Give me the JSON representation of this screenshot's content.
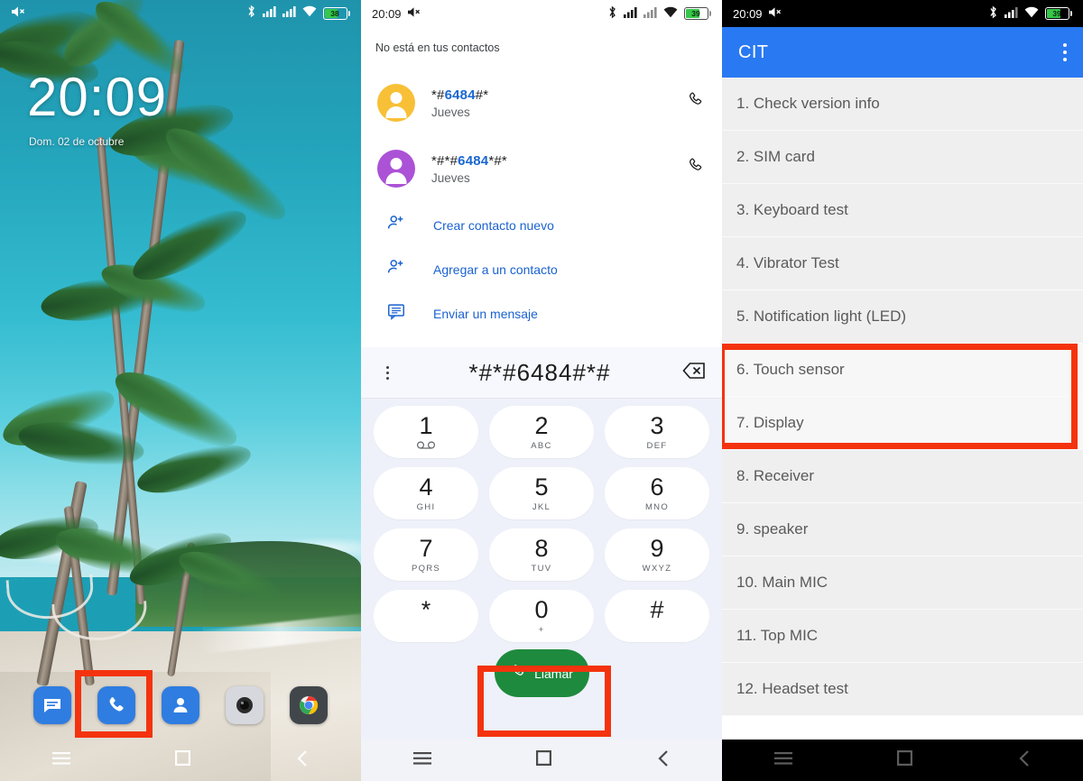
{
  "lockscreen": {
    "statusbar": {
      "mute_icon": "volume-mute-icon",
      "bluetooth_icon": "bluetooth-icon",
      "signal1_icon": "cell-signal-icon",
      "signal2_icon": "cell-signal-icon",
      "wifi_icon": "wifi-icon",
      "battery_level": "38"
    },
    "clock": "20:09",
    "date": "Dom. 02 de octubre",
    "dock": [
      {
        "name": "messages-app-icon",
        "label": "Messages",
        "highlighted": false
      },
      {
        "name": "phone-app-icon",
        "label": "Phone",
        "highlighted": true
      },
      {
        "name": "contacts-app-icon",
        "label": "Contacts",
        "highlighted": false
      },
      {
        "name": "camera-app-icon",
        "label": "Camera",
        "highlighted": false
      },
      {
        "name": "chrome-app-icon",
        "label": "Chrome",
        "highlighted": false
      }
    ],
    "navbar": [
      "menu-icon",
      "home-square-icon",
      "back-chevron-icon"
    ]
  },
  "dialer": {
    "statusbar": {
      "time": "20:09",
      "mute_icon": "volume-mute-icon",
      "battery_level": "39"
    },
    "not_in_contacts": "No está en tus contactos",
    "call_entries": [
      {
        "number_prefix": "*#",
        "number_highlight": "6484",
        "number_suffix": "#*",
        "full_number": "*#6484#*",
        "subtitle": "Jueves",
        "avatar_color": "#f8c037",
        "call_icon": "phone-handset-icon"
      },
      {
        "number_prefix": "*#*#",
        "number_highlight": "6484",
        "number_suffix": "*#*",
        "full_number": "*#*#6484*#*",
        "subtitle": "Jueves",
        "avatar_color": "#ab52d6",
        "call_icon": "phone-handset-icon"
      }
    ],
    "actions": [
      {
        "icon": "person-add-icon",
        "label": "Crear contacto nuevo"
      },
      {
        "icon": "person-add-icon",
        "label": "Agregar a un contacto"
      },
      {
        "icon": "message-icon",
        "label": "Enviar un mensaje"
      }
    ],
    "input": {
      "value": "*#*#6484#*#",
      "overflow_icon": "more-vert-icon",
      "backspace_icon": "backspace-icon"
    },
    "keypad": [
      {
        "digit": "1",
        "sub": "⌀⌀",
        "sub_name": "voicemail-icon"
      },
      {
        "digit": "2",
        "sub": "ABC"
      },
      {
        "digit": "3",
        "sub": "DEF"
      },
      {
        "digit": "4",
        "sub": "GHI"
      },
      {
        "digit": "5",
        "sub": "JKL"
      },
      {
        "digit": "6",
        "sub": "MNO"
      },
      {
        "digit": "7",
        "sub": "PQRS"
      },
      {
        "digit": "8",
        "sub": "TUV"
      },
      {
        "digit": "9",
        "sub": "WXYZ"
      },
      {
        "digit": "*",
        "sub": ""
      },
      {
        "digit": "0",
        "sub": "+"
      },
      {
        "digit": "#",
        "sub": ""
      }
    ],
    "call_button": {
      "label": "Llamar",
      "icon": "phone-handset-icon",
      "color": "#1e8a3e",
      "highlighted": true
    },
    "navbar": [
      "menu-icon",
      "home-square-icon",
      "back-chevron-icon"
    ]
  },
  "cit": {
    "statusbar": {
      "time": "20:09",
      "mute_icon": "volume-mute-icon",
      "battery_level": "39"
    },
    "appbar": {
      "title": "CIT",
      "overflow_icon": "more-vert-icon",
      "color": "#2979f2"
    },
    "items": [
      {
        "label": "1. Check version info",
        "highlighted": false
      },
      {
        "label": "2. SIM card",
        "highlighted": false
      },
      {
        "label": "3. Keyboard test",
        "highlighted": false
      },
      {
        "label": "4. Vibrator Test",
        "highlighted": false
      },
      {
        "label": "5. Notification light (LED)",
        "highlighted": false
      },
      {
        "label": "6. Touch sensor",
        "highlighted": true
      },
      {
        "label": "7. Display",
        "highlighted": true
      },
      {
        "label": "8. Receiver",
        "highlighted": false
      },
      {
        "label": "9. speaker",
        "highlighted": false
      },
      {
        "label": "10. Main MIC",
        "highlighted": false
      },
      {
        "label": "11. Top MIC",
        "highlighted": false
      },
      {
        "label": "12. Headset test",
        "highlighted": false
      }
    ],
    "navbar": [
      "menu-icon",
      "home-square-icon",
      "back-chevron-icon"
    ]
  },
  "annotation": {
    "highlight_color": "#f4330e"
  }
}
